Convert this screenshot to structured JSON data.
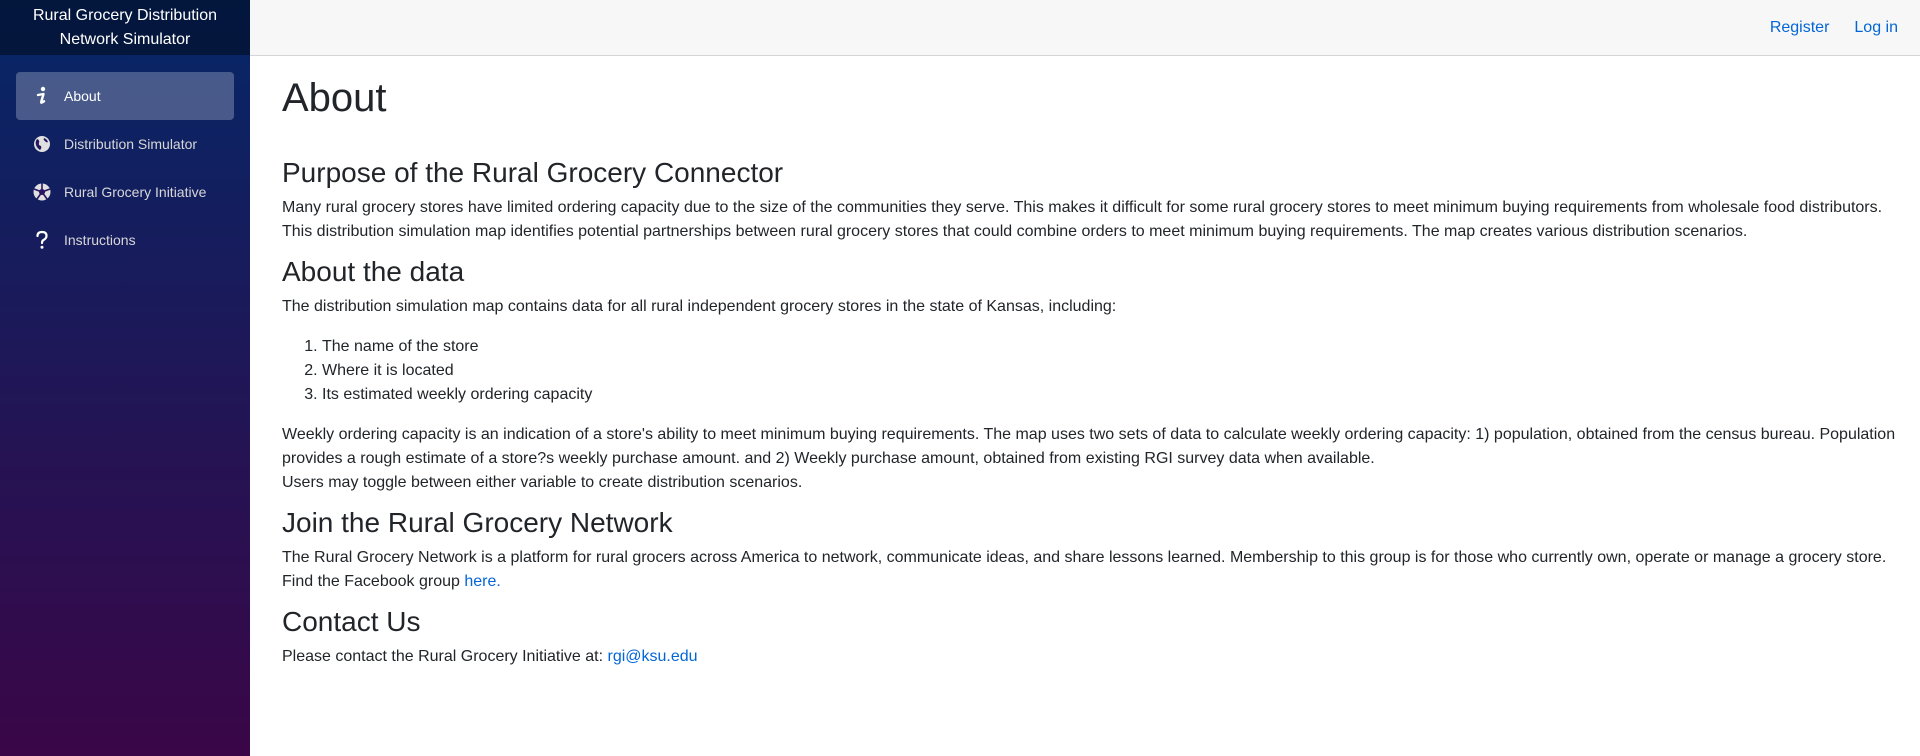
{
  "sidebar": {
    "brand": "Rural Grocery Distribution Network Simulator",
    "items": [
      {
        "label": "About",
        "icon": "info-icon",
        "active": true
      },
      {
        "label": "Distribution Simulator",
        "icon": "globe-icon"
      },
      {
        "label": "Rural Grocery Initiative",
        "icon": "aperture-icon"
      },
      {
        "label": "Instructions",
        "icon": "question-icon"
      }
    ]
  },
  "topbar": {
    "register": "Register",
    "login": "Log in"
  },
  "page": {
    "title": "About",
    "purpose": {
      "heading": "Purpose of the Rural Grocery Connector",
      "text": "Many rural grocery stores have limited ordering capacity due to the size of the communities they serve. This makes it difficult for some rural grocery stores to meet minimum buying requirements from wholesale food distributors. This distribution simulation map identifies potential partnerships between rural grocery stores that could combine orders to meet minimum buying requirements. The map creates various distribution scenarios."
    },
    "data": {
      "heading": "About the data",
      "intro": "The distribution simulation map contains data for all rural independent grocery stores in the state of Kansas, including:",
      "items": [
        "The name of the store",
        "Where it is located",
        "Its estimated weekly ordering capacity"
      ],
      "capacity": "Weekly ordering capacity is an indication of a store's ability to meet minimum buying requirements. The map uses two sets of data to calculate weekly ordering capacity: 1) population, obtained from the census bureau. Population provides a rough estimate of a store?s weekly purchase amount. and 2) Weekly purchase amount, obtained from existing RGI survey data when available.",
      "toggle": "Users may toggle between either variable to create distribution scenarios."
    },
    "join": {
      "heading": "Join the Rural Grocery Network",
      "text": "The Rural Grocery Network is a platform for rural grocers across America to network, communicate ideas, and share lessons learned. Membership to this group is for those who currently own, operate or manage a grocery store. Find the Facebook group ",
      "link": "here."
    },
    "contact": {
      "heading": "Contact Us",
      "text": "Please contact the Rural Grocery Initiative at: ",
      "email": "rgi@ksu.edu"
    }
  },
  "colors": {
    "sidebar_top": "#052767",
    "sidebar_bottom": "#3a0647",
    "link": "#0366d6",
    "topbar_bg": "#f7f7f7"
  }
}
